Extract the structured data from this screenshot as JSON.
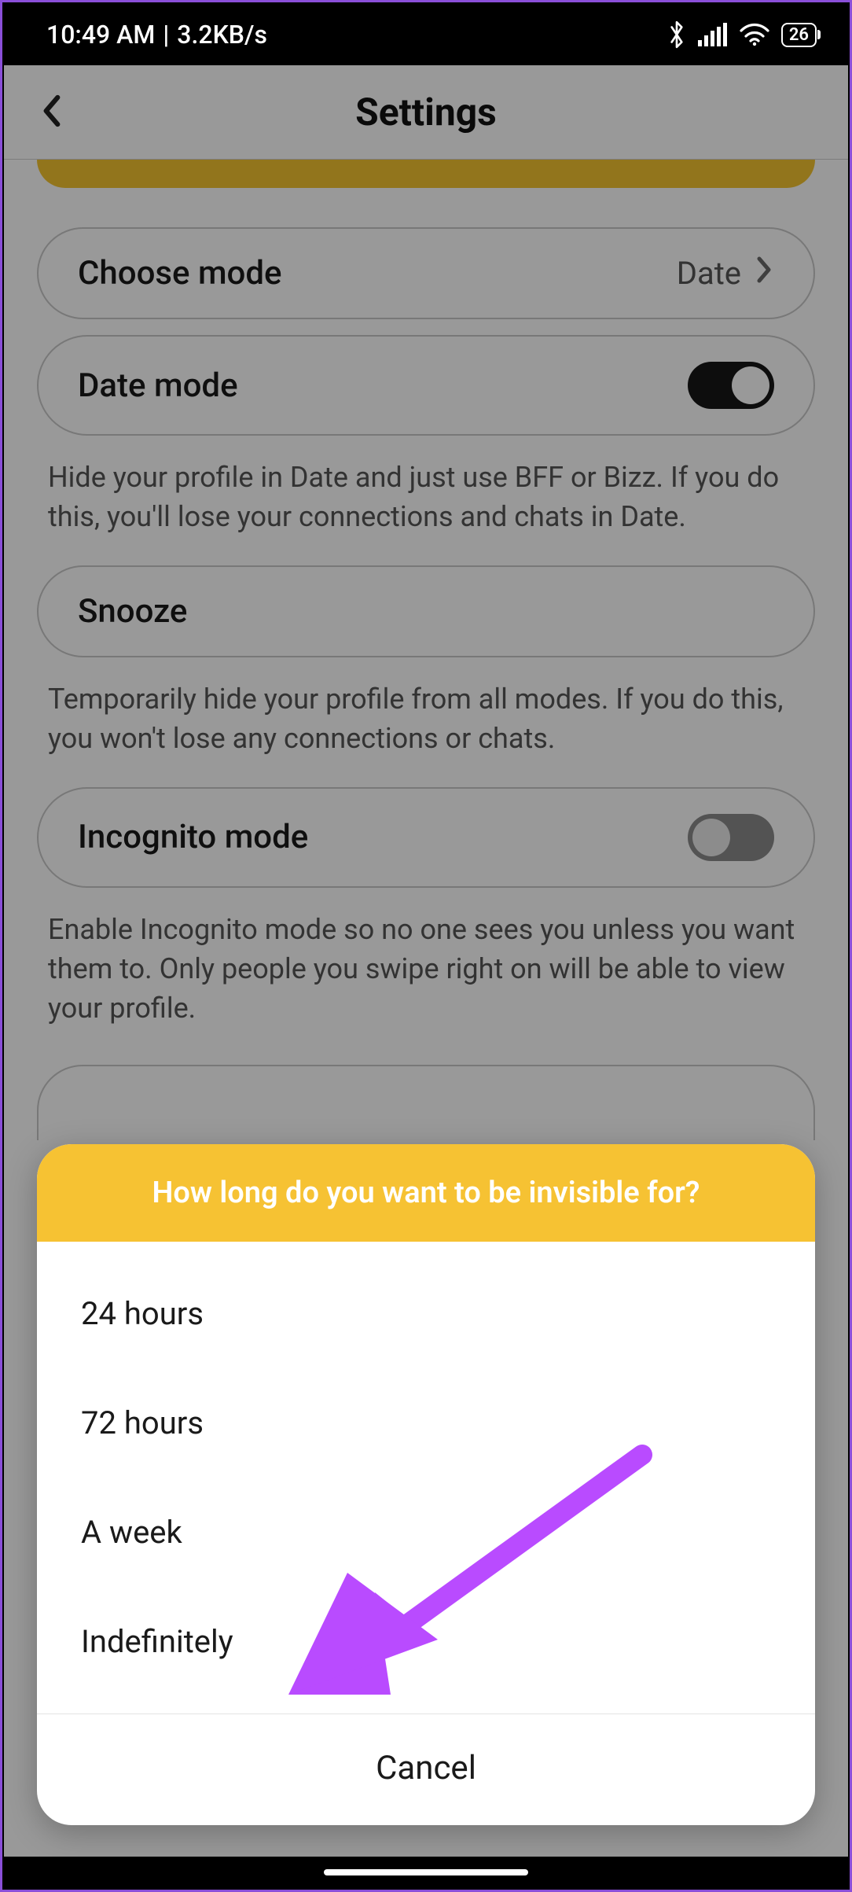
{
  "statusbar": {
    "time": "10:49 AM",
    "transfer": "3.2KB/s",
    "battery": "26"
  },
  "appbar": {
    "title": "Settings"
  },
  "rows": {
    "choose_mode": {
      "label": "Choose mode",
      "value": "Date"
    },
    "date_mode": {
      "label": "Date mode"
    },
    "snooze": {
      "label": "Snooze"
    },
    "incognito": {
      "label": "Incognito mode"
    }
  },
  "descriptions": {
    "date_mode": "Hide your profile in Date and just use BFF or Bizz. If you do this, you'll lose your connections and chats in Date.",
    "snooze": "Temporarily hide your profile from all modes. If you do this, you won't lose any connections or chats.",
    "incognito": "Enable Incognito mode so no one sees you unless you want them to. Only people you swipe right on will be able to view your profile."
  },
  "sheet": {
    "title": "How long do you want to be invisible for?",
    "options": [
      "24 hours",
      "72 hours",
      "A week",
      "Indefinitely"
    ],
    "cancel": "Cancel"
  },
  "annotation": {
    "arrow_color": "#b94bff"
  }
}
